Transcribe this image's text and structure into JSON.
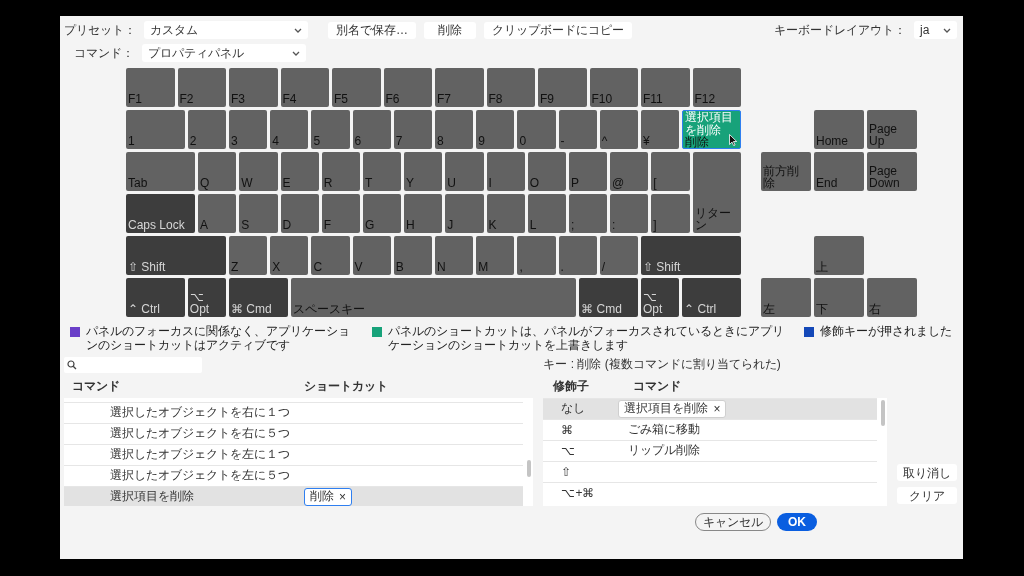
{
  "toolbar": {
    "preset_label": "プリセット：",
    "preset": "カスタム",
    "buttons": [
      "別名で保存…",
      "削除",
      "クリップボードにコピー"
    ],
    "layout_label": "キーボードレイアウト：",
    "layout": "ja",
    "command_label": "コマンド：",
    "command": "プロパティパネル"
  },
  "keyboard": {
    "rows": [
      {
        "keys": [
          {
            "label": "F1",
            "kind": "function"
          },
          {
            "label": "F2",
            "kind": "function"
          },
          {
            "label": "F3",
            "kind": "function"
          },
          {
            "label": "F4",
            "kind": "function"
          },
          {
            "label": "F5",
            "kind": "function"
          },
          {
            "label": "F6",
            "kind": "function"
          },
          {
            "label": "F7",
            "kind": "function"
          },
          {
            "label": "F8",
            "kind": "function"
          },
          {
            "label": "F9",
            "kind": "function"
          },
          {
            "label": "F10",
            "kind": "function"
          },
          {
            "label": "F11",
            "kind": "function"
          },
          {
            "label": "F12",
            "kind": "function"
          }
        ]
      },
      {
        "keys": [
          {
            "label": "1",
            "kind": "number_one"
          },
          {
            "label": "2",
            "kind": "key"
          },
          {
            "label": "3",
            "kind": "key"
          },
          {
            "label": "4",
            "kind": "key"
          },
          {
            "label": "5",
            "kind": "key"
          },
          {
            "label": "6",
            "kind": "key"
          },
          {
            "label": "7",
            "kind": "key"
          },
          {
            "label": "8",
            "kind": "key"
          },
          {
            "label": "9",
            "kind": "key"
          },
          {
            "label": "0",
            "kind": "key"
          },
          {
            "label": "-",
            "kind": "key"
          },
          {
            "label": "^",
            "kind": "key"
          },
          {
            "label": "¥",
            "kind": "key"
          },
          {
            "label": "削除",
            "kind": "backspace",
            "color": "#17a27a",
            "command": "選択項目を削除"
          }
        ]
      },
      {
        "keys": [
          {
            "label": "Tab",
            "kind": "wide"
          },
          {
            "label": "Q",
            "kind": "key"
          },
          {
            "label": "W",
            "kind": "key"
          },
          {
            "label": "E",
            "kind": "key"
          },
          {
            "label": "R",
            "kind": "key"
          },
          {
            "label": "T",
            "kind": "key"
          },
          {
            "label": "Y",
            "kind": "key"
          },
          {
            "label": "U",
            "kind": "key"
          },
          {
            "label": "I",
            "kind": "key"
          },
          {
            "label": "O",
            "kind": "key"
          },
          {
            "label": "P",
            "kind": "key"
          },
          {
            "label": "@",
            "kind": "key"
          },
          {
            "label": "[",
            "kind": "key"
          },
          {
            "label": "リターン",
            "kind": "return"
          }
        ]
      },
      {
        "keys": [
          {
            "label": "Caps Lock",
            "kind": "caps"
          },
          {
            "label": "A",
            "kind": "key"
          },
          {
            "label": "S",
            "kind": "key"
          },
          {
            "label": "D",
            "kind": "key"
          },
          {
            "label": "F",
            "kind": "key"
          },
          {
            "label": "G",
            "kind": "key"
          },
          {
            "label": "H",
            "kind": "key"
          },
          {
            "label": "J",
            "kind": "key"
          },
          {
            "label": "K",
            "kind": "key"
          },
          {
            "label": "L",
            "kind": "key"
          },
          {
            "label": ";",
            "kind": "key"
          },
          {
            "label": ":",
            "kind": "key"
          },
          {
            "label": "]",
            "kind": "key"
          }
        ]
      },
      {
        "keys": [
          {
            "label": "⇧ Shift",
            "kind": "shift"
          },
          {
            "label": "Z",
            "kind": "key"
          },
          {
            "label": "X",
            "kind": "key"
          },
          {
            "label": "C",
            "kind": "key"
          },
          {
            "label": "V",
            "kind": "key"
          },
          {
            "label": "B",
            "kind": "key"
          },
          {
            "label": "N",
            "kind": "key"
          },
          {
            "label": "M",
            "kind": "key"
          },
          {
            "label": ",",
            "kind": "key"
          },
          {
            "label": ".",
            "kind": "key"
          },
          {
            "label": "/",
            "kind": "key"
          },
          {
            "label": "⇧ Shift",
            "kind": "shift"
          }
        ]
      },
      {
        "keys": [
          {
            "label": "⌃ Ctrl",
            "kind": "ctrl"
          },
          {
            "label": "⌥ Opt",
            "kind": "opt"
          },
          {
            "label": "⌘ Cmd",
            "kind": "cmd"
          },
          {
            "label": "スペースキー",
            "kind": "space"
          },
          {
            "label": "⌘ Cmd",
            "kind": "cmd"
          },
          {
            "label": "⌥ Opt",
            "kind": "opt"
          },
          {
            "label": "⌃ Ctrl",
            "kind": "ctrl"
          }
        ]
      }
    ],
    "nav_keys": [
      {
        "label": "Home",
        "kind": "home"
      },
      {
        "label": "Page Up",
        "kind": "page_up"
      },
      {
        "label": "前方削除",
        "kind": "forward_delete"
      },
      {
        "label": "End",
        "kind": "end"
      },
      {
        "label": "Page Down",
        "kind": "page_down"
      },
      {
        "label": "上",
        "kind": "up"
      },
      {
        "label": "左",
        "kind": "left"
      },
      {
        "label": "下",
        "kind": "down"
      },
      {
        "label": "右",
        "kind": "right"
      }
    ]
  },
  "legend": [
    {
      "color": "#6a3fc8",
      "text": "パネルのフォーカスに関係なく、アプリケーションのショートカットはアクティブです"
    },
    {
      "color": "#17a27a",
      "text": "パネルのショートカットは、パネルがフォーカスされているときにアプリケーションのショートカットを上書きします"
    },
    {
      "color": "#1448b8",
      "text": "修飾キーが押されました"
    }
  ],
  "commands": {
    "columns": [
      "コマンド",
      "ショートカット"
    ],
    "rows": [
      {
        "command": "選択したオブジェクトを右に１つ",
        "selected": false
      },
      {
        "command": "選択したオブジェクトを右に５つ",
        "selected": false
      },
      {
        "command": "選択したオブジェクトを左に１つ",
        "selected": false
      },
      {
        "command": "選択したオブジェクトを左に５つ",
        "selected": false
      },
      {
        "command": "選択項目を削除",
        "selected": true,
        "shortcuts": [
          {
            "label": "削除",
            "close": "×",
            "focused": true
          }
        ]
      }
    ]
  },
  "key_info": "キー : 削除 (複数コマンドに割り当てられた)",
  "modifiers": {
    "columns": [
      "修飾子",
      "コマンド"
    ],
    "rows": [
      {
        "modifier": "なし",
        "selected": true,
        "kind": "chip",
        "command": "選択項目を削除",
        "close": "×"
      },
      {
        "modifier": "⌘",
        "selected": false,
        "kind": "text",
        "command": "ごみ箱に移動"
      },
      {
        "modifier": "⌥",
        "selected": false,
        "kind": "text",
        "command": "リップル削除"
      },
      {
        "modifier": "⇧",
        "selected": false,
        "kind": "empty"
      },
      {
        "modifier": "⌥+⌘",
        "selected": false,
        "kind": "empty"
      }
    ]
  },
  "side_buttons": [
    "取り消し",
    "クリア"
  ],
  "footer": [
    {
      "label": "キャンセル",
      "primary": false
    },
    {
      "label": "OK",
      "primary": true
    }
  ]
}
